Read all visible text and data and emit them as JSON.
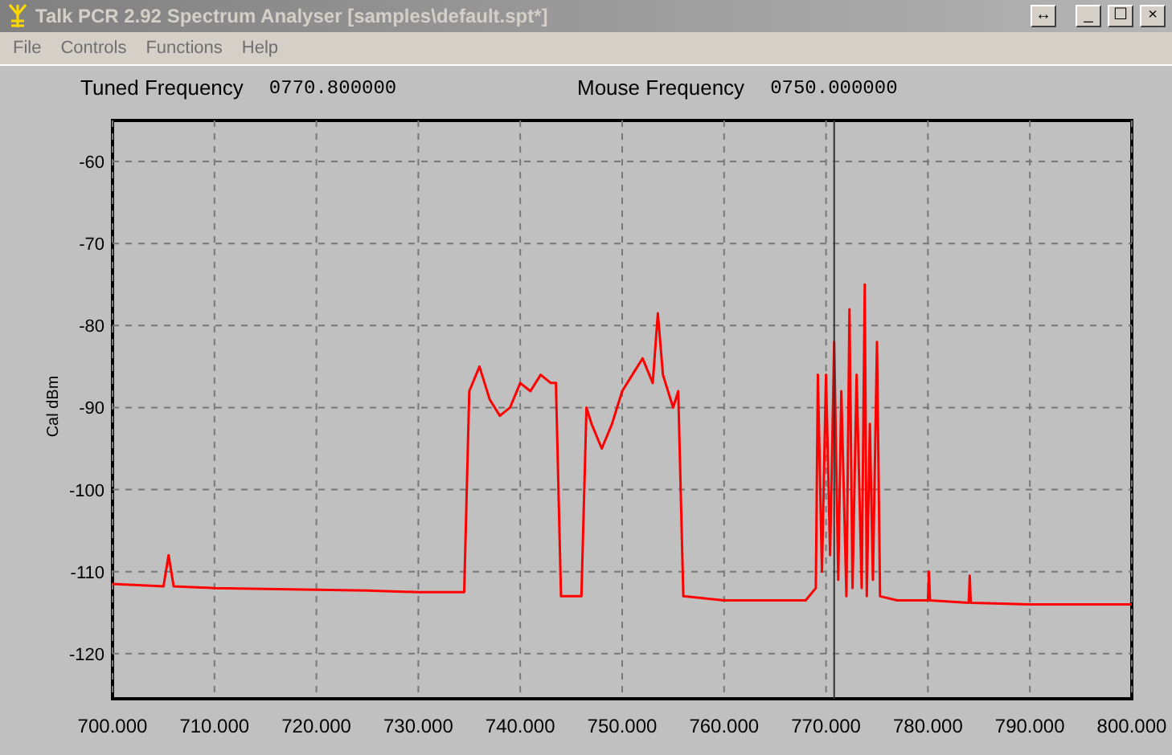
{
  "window": {
    "title": "Talk PCR 2.92 Spectrum Analyser [samples\\default.spt*]",
    "buttons": [
      "↔",
      "_",
      "☐",
      "×"
    ]
  },
  "menu": [
    "File",
    "Controls",
    "Functions",
    "Help"
  ],
  "readouts": [
    {
      "label": "Tuned Frequency",
      "value": "0770.800000"
    },
    {
      "label": "Mouse Frequency",
      "value": "0750.000000"
    }
  ],
  "chart_data": {
    "type": "line",
    "ylabel": "Cal dBm",
    "xlim": [
      700,
      800
    ],
    "ylim": [
      -125.5,
      -55
    ],
    "xticks": [
      {
        "value": 700,
        "label": "700.000"
      },
      {
        "value": 710,
        "label": "710.000"
      },
      {
        "value": 720,
        "label": "720.000"
      },
      {
        "value": 730,
        "label": "730.000"
      },
      {
        "value": 740,
        "label": "740.000"
      },
      {
        "value": 750,
        "label": "750.000"
      },
      {
        "value": 760,
        "label": "760.000"
      },
      {
        "value": 770,
        "label": "770.000"
      },
      {
        "value": 780,
        "label": "780.000"
      },
      {
        "value": 790,
        "label": "790.000"
      },
      {
        "value": 800,
        "label": "800.000"
      }
    ],
    "yticks": [
      -60,
      -70,
      -80,
      -90,
      -100,
      -110,
      -120
    ],
    "x": [
      700,
      705,
      705.5,
      706,
      710,
      720,
      725,
      730,
      734.5,
      735,
      736,
      737,
      738,
      739,
      740,
      741,
      742,
      743,
      743.5,
      744,
      746,
      746.5,
      747,
      748,
      749,
      750,
      751,
      752,
      753,
      753.5,
      754,
      755,
      755.5,
      756,
      760,
      768,
      769,
      769.2,
      769.6,
      770,
      770.4,
      770.8,
      771.2,
      771.5,
      772,
      772.3,
      772.6,
      773,
      773.5,
      773.8,
      774,
      774.3,
      774.6,
      775,
      775.3,
      777,
      780,
      780.1,
      780.2,
      784,
      784.1,
      784.2,
      790,
      800
    ],
    "series": [
      {
        "color": "#ff0000",
        "values": [
          -111.5,
          -111.8,
          -108,
          -111.8,
          -112,
          -112.2,
          -112.3,
          -112.5,
          -112.5,
          -88,
          -85,
          -89,
          -91,
          -90,
          -87,
          -88,
          -86,
          -87,
          -87,
          -113,
          -113,
          -90,
          -92,
          -95,
          -92,
          -88,
          -86,
          -84,
          -87,
          -78.5,
          -86,
          -90,
          -88,
          -113,
          -113.5,
          -113.5,
          -112,
          -86,
          -110,
          -86,
          -108,
          -82,
          -111,
          -88,
          -113,
          -78,
          -112,
          -86,
          -112,
          -75,
          -113,
          -92,
          -111,
          -82,
          -113,
          -113.5,
          -113.5,
          -110,
          -113.5,
          -113.8,
          -110.5,
          -113.8,
          -114,
          -114
        ]
      }
    ],
    "grid": true,
    "ref_lines": [
      {
        "axis": "x",
        "value": 770.8,
        "color": "#333333"
      }
    ]
  }
}
